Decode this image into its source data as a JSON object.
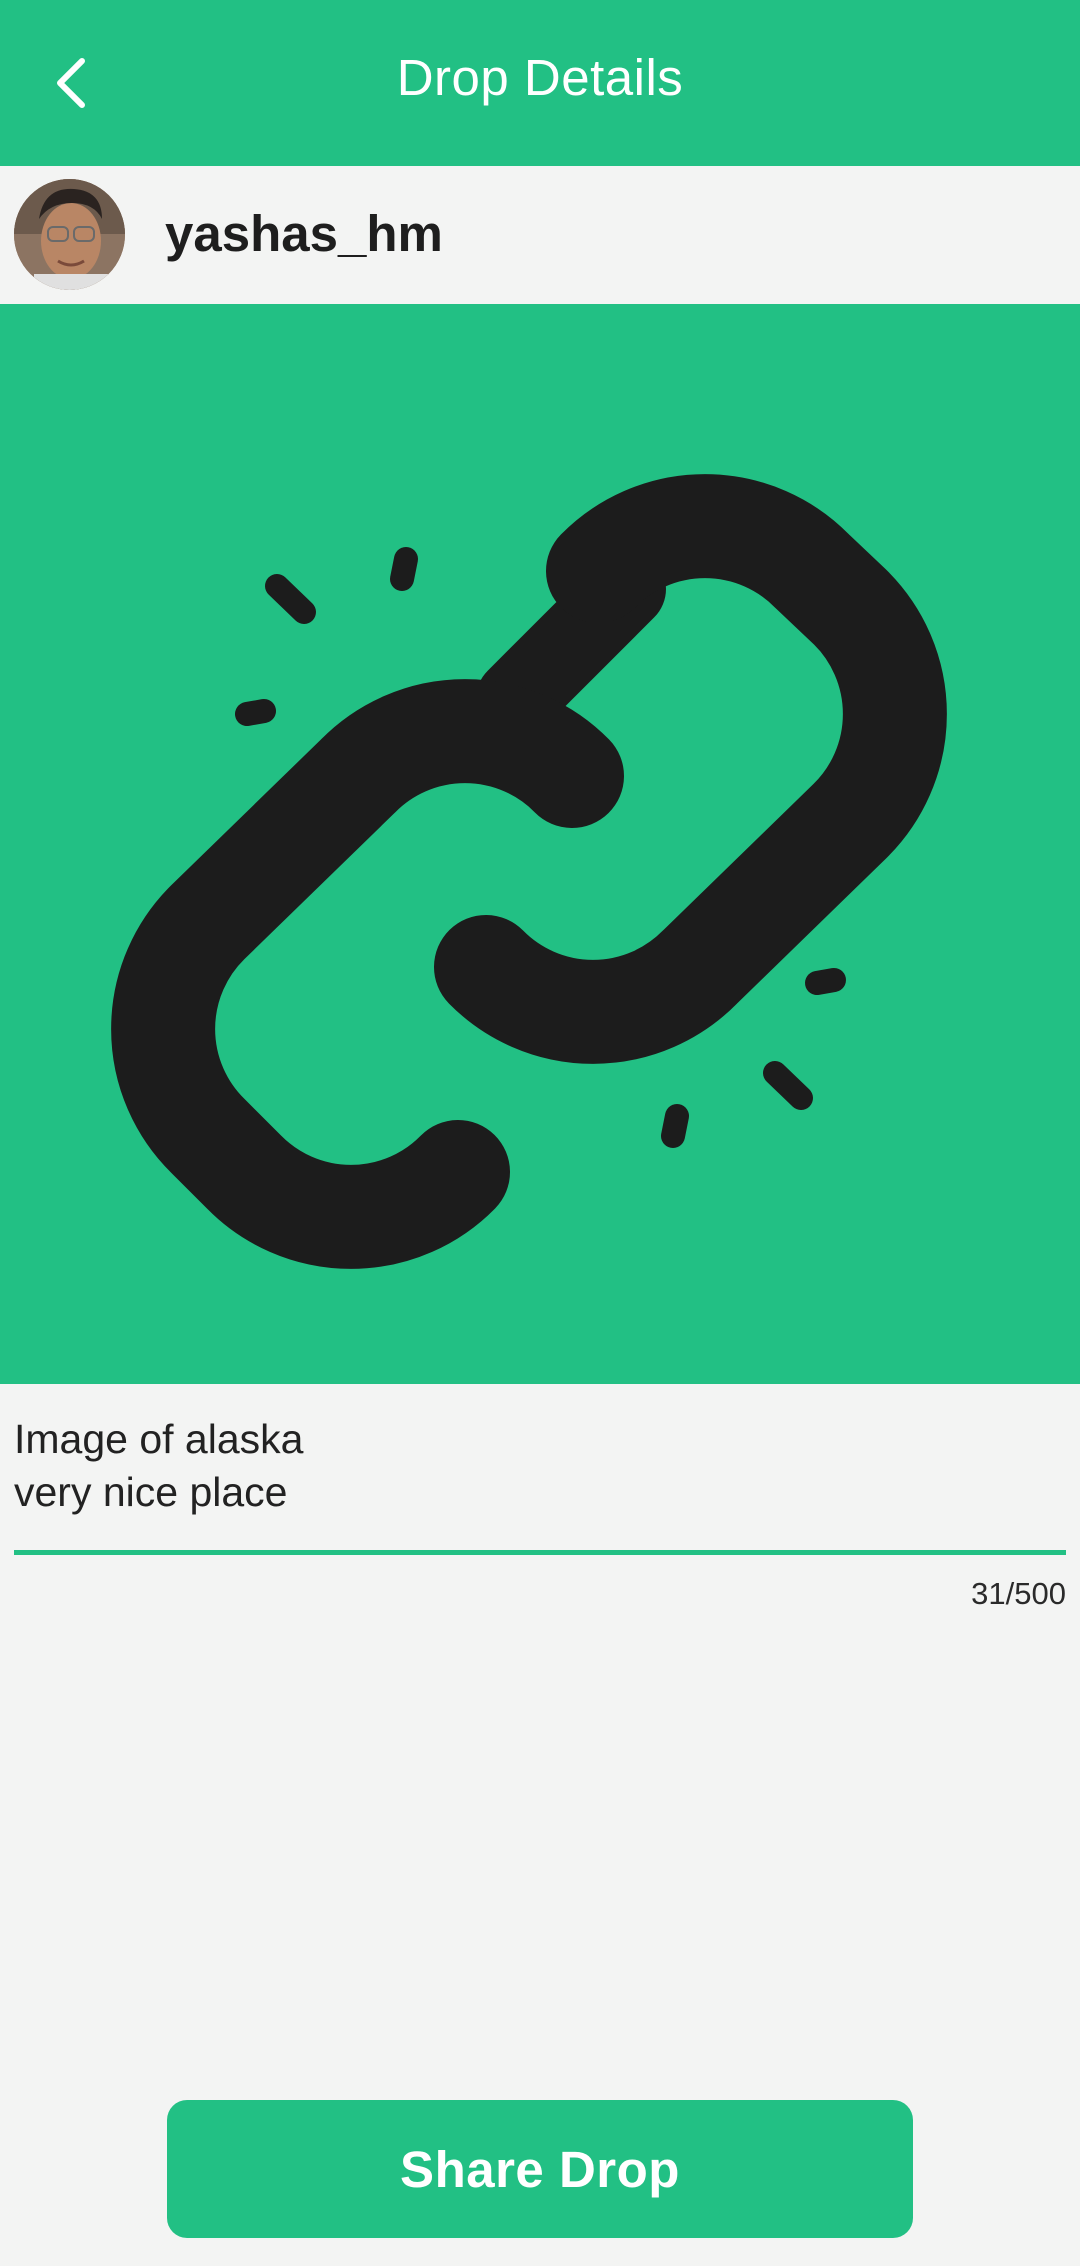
{
  "header": {
    "title": "Drop Details",
    "back_icon": "chevron-left-icon",
    "background_color": "#22c084"
  },
  "user": {
    "username": "yashas_hm",
    "avatar_icon": "avatar"
  },
  "drop": {
    "image_icon": "link-icon",
    "image_background": "#22c084"
  },
  "description": {
    "lines": [
      "Image of alaska",
      "very nice place"
    ],
    "char_count": "31/500"
  },
  "actions": {
    "share_label": "Share Drop"
  },
  "colors": {
    "accent": "#22c084",
    "background": "#f3f4f3",
    "text": "#1c1c1c"
  }
}
